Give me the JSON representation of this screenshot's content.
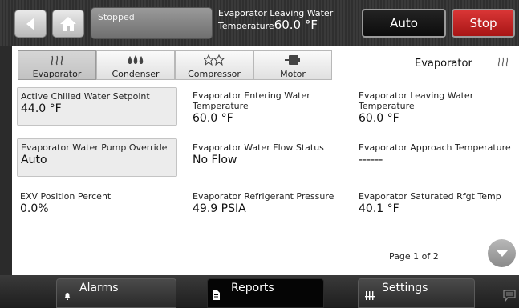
{
  "header": {
    "status_text": "Stopped",
    "lw_label_line1": "Evaporator Leaving Water",
    "lw_label_line2": "Temperature",
    "lw_value": "60.0 °F",
    "auto_label": "Auto",
    "stop_label": "Stop"
  },
  "tabs": [
    {
      "label": "Evaporator",
      "icon": "evaporator-icon",
      "active": true
    },
    {
      "label": "Condenser",
      "icon": "condenser-icon",
      "active": false
    },
    {
      "label": "Compressor",
      "icon": "compressor-icon",
      "active": false
    },
    {
      "label": "Motor",
      "icon": "motor-icon",
      "active": false
    }
  ],
  "section": {
    "title": "Evaporator",
    "icon": "evaporator-icon"
  },
  "cells": [
    {
      "label": "Active Chilled Water Setpoint",
      "value": "44.0 °F"
    },
    {
      "label": "Evaporator Entering Water Temperature",
      "value": "60.0 °F"
    },
    {
      "label": "Evaporator Leaving Water Temperature",
      "value": "60.0 °F"
    },
    {
      "label": "Evaporator Water Pump Override",
      "value": "Auto"
    },
    {
      "label": "Evaporator Water Flow Status",
      "value": "No Flow"
    },
    {
      "label": "Evaporator Approach Temperature",
      "value": "------"
    },
    {
      "label": "EXV Position Percent",
      "value": "0.0%"
    },
    {
      "label": "Evaporator Refrigerant Pressure",
      "value": "49.9 PSIA"
    },
    {
      "label": "Evaporator Saturated Rfgt Temp",
      "value": "40.1 °F"
    }
  ],
  "pagination": {
    "label": "Page 1 of 2"
  },
  "bottom_nav": [
    {
      "label": "Alarms",
      "icon": "bell-icon"
    },
    {
      "label": "Reports",
      "icon": "document-icon",
      "active": true
    },
    {
      "label": "Settings",
      "icon": "sliders-icon"
    }
  ],
  "colors": {
    "stop": "#c62020",
    "panel": "#ffffff",
    "bar": "#2b2b2b"
  }
}
